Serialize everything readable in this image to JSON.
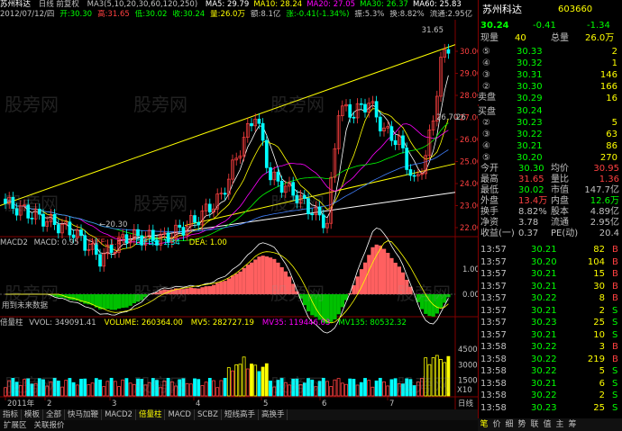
{
  "title": {
    "stock_name": "苏州科达",
    "code": "603660",
    "period_label": "日线 前复权"
  },
  "ma_header": {
    "label": "MA3(5,10,20,30,60,120,250)",
    "items": [
      {
        "text": "MA5: 29.79",
        "color": "#ffffff"
      },
      {
        "text": "MA10: 28.24",
        "color": "#ffff00"
      },
      {
        "text": "MA20: 27.05",
        "color": "#ff00ff"
      },
      {
        "text": "MA30: 26.37",
        "color": "#00ff00"
      },
      {
        "text": "MA60: 25.83",
        "color": "#ffffff"
      }
    ]
  },
  "info_header": {
    "items": [
      {
        "text": "2012/07/12/四",
        "color": "#c0c0c0"
      },
      {
        "text": "开:30.30",
        "color": "#00ff00"
      },
      {
        "text": "高:31.65",
        "color": "#ff4040"
      },
      {
        "text": "低:30.02",
        "color": "#00ff00"
      },
      {
        "text": "收:30.24",
        "color": "#00ff00"
      },
      {
        "text": "量:26.0万",
        "color": "#ffff00"
      },
      {
        "text": "额:8.1亿",
        "color": "#c0c0c0"
      },
      {
        "text": "涨:-0.41(-1.34%)",
        "color": "#00ff00"
      },
      {
        "text": "振:5.3%",
        "color": "#c0c0c0"
      },
      {
        "text": "换:8.82%",
        "color": "#c0c0c0"
      },
      {
        "text": "流通:2.95亿",
        "color": "#c0c0c0"
      }
    ]
  },
  "price_axis": [
    "30.00",
    "29.00",
    "28.00",
    "27.00",
    "26.00",
    "25.00",
    "24.00",
    "23.00",
    "22.00"
  ],
  "price_annotations": {
    "high": "31.65",
    "mid_label": "26.70",
    "mid_label2": "26",
    "low": "20.30"
  },
  "macd_header": {
    "name": "MACD2",
    "items": [
      {
        "text": "MACD: 0.95",
        "color": "#c0c0c0"
      },
      {
        "text": "DIFF: 1.47",
        "color": "#ff4040"
      },
      {
        "text": "DIFBS: 1.34",
        "color": "#00ffff"
      },
      {
        "text": "DEA: 1.00",
        "color": "#ffff00"
      }
    ],
    "axis": [
      "1.00",
      "0.00"
    ],
    "note": "用到未来数据"
  },
  "vol_header": {
    "name": "倍量柱",
    "items": [
      {
        "text": "VVOL: 349091.41",
        "color": "#c0c0c0"
      },
      {
        "text": "VOLUME: 260364.00",
        "color": "#ffff00"
      },
      {
        "text": "MV5: 282727.19",
        "color": "#ffff00"
      },
      {
        "text": "MV35: 119446.03",
        "color": "#ff00ff"
      },
      {
        "text": "MV135: 80532.32",
        "color": "#00ff00"
      }
    ],
    "axis": [
      "45000",
      "30000",
      "15000"
    ],
    "unit": "X10"
  },
  "x_axis": {
    "labels": [
      "2011年",
      "2",
      "3",
      "4",
      "5",
      "6",
      "7"
    ],
    "period": "日线"
  },
  "bottom_tabs": [
    "指标",
    "模板",
    "全部",
    "快马加鞭",
    "MACD2",
    "倍量柱",
    "MACD",
    "SCBZ",
    "短线高手",
    "高换手"
  ],
  "bottom_tabs_active": "倍量柱",
  "bottom_tabs2": [
    "扩展区",
    "关联报价"
  ],
  "right_panel": {
    "price": "30.24",
    "change": "-0.41",
    "pct": "-1.34",
    "current_label": "现量",
    "current_vol": "40",
    "total_label": "总量",
    "total_vol": "26.0万",
    "sell_orders": [
      {
        "level": "⑤",
        "price": "30.33",
        "vol": "2"
      },
      {
        "level": "④",
        "price": "30.32",
        "vol": "1"
      },
      {
        "level": "③",
        "price": "30.31",
        "vol": "146"
      },
      {
        "level": "②",
        "price": "30.30",
        "vol": "166"
      },
      {
        "level": "①",
        "price": "30.29",
        "vol": "16"
      }
    ],
    "sell_label": "卖盘",
    "buy_label": "买盘",
    "buy_orders": [
      {
        "level": "①",
        "price": "30.24",
        "vol": ""
      },
      {
        "level": "②",
        "price": "30.23",
        "vol": "5"
      },
      {
        "level": "③",
        "price": "30.22",
        "vol": "63"
      },
      {
        "level": "④",
        "price": "30.21",
        "vol": "86"
      },
      {
        "level": "⑤",
        "price": "30.20",
        "vol": "270"
      }
    ],
    "stats": [
      {
        "l1": "今开",
        "v1": "30.30",
        "c1": "#00ff00",
        "l2": "均价",
        "v2": "30.95",
        "c2": "#ff4040"
      },
      {
        "l1": "最高",
        "v1": "31.65",
        "c1": "#ff4040",
        "l2": "量比",
        "v2": "1.36",
        "c2": "#ff4040"
      },
      {
        "l1": "最低",
        "v1": "30.02",
        "c1": "#00ff00",
        "l2": "市值",
        "v2": "147.7亿",
        "c2": "#c0c0c0"
      },
      {
        "l1": "外盘",
        "v1": "13.4万",
        "c1": "#ff4040",
        "l2": "内盘",
        "v2": "12.6万",
        "c2": "#00ff00"
      },
      {
        "l1": "换手",
        "v1": "8.82%",
        "c1": "#c0c0c0",
        "l2": "股本",
        "v2": "4.89亿",
        "c2": "#c0c0c0"
      },
      {
        "l1": "净资",
        "v1": "3.78",
        "c1": "#c0c0c0",
        "l2": "流通",
        "v2": "2.95亿",
        "c2": "#c0c0c0"
      },
      {
        "l1": "收益(一)",
        "v1": "0.37",
        "c1": "#c0c0c0",
        "l2": "PE(动)",
        "v2": "20.4",
        "c2": "#c0c0c0"
      }
    ],
    "ticks": [
      {
        "time": "13:57",
        "price": "30.21",
        "vol": "82",
        "bs": "B"
      },
      {
        "time": "13:57",
        "price": "30.20",
        "vol": "104",
        "bs": "B"
      },
      {
        "time": "13:57",
        "price": "30.21",
        "vol": "15",
        "bs": "B"
      },
      {
        "time": "13:57",
        "price": "30.21",
        "vol": "30",
        "bs": "B"
      },
      {
        "time": "13:57",
        "price": "30.22",
        "vol": "8",
        "bs": "B"
      },
      {
        "time": "13:57",
        "price": "30.21",
        "vol": "2",
        "bs": "S"
      },
      {
        "time": "13:57",
        "price": "30.23",
        "vol": "25",
        "bs": "S"
      },
      {
        "time": "13:57",
        "price": "30.21",
        "vol": "10",
        "bs": "S"
      },
      {
        "time": "13:58",
        "price": "30.22",
        "vol": "3",
        "bs": "B"
      },
      {
        "time": "13:58",
        "price": "30.22",
        "vol": "219",
        "bs": "B"
      },
      {
        "time": "13:58",
        "price": "30.22",
        "vol": "5",
        "bs": "S"
      },
      {
        "time": "13:58",
        "price": "30.21",
        "vol": "6",
        "bs": "S"
      },
      {
        "time": "13:58",
        "price": "30.22",
        "vol": "2",
        "bs": "S"
      },
      {
        "time": "13:58",
        "price": "30.23",
        "vol": "25",
        "bs": "S"
      }
    ],
    "tabs": [
      "笔",
      "价",
      "细",
      "势",
      "联",
      "值",
      "主",
      "筹"
    ],
    "tab_active": "笔"
  },
  "watermark": "股旁网",
  "colors": {
    "up": "#ff4040",
    "down": "#00ff00",
    "axis": "#800000",
    "yellow": "#ffff00",
    "cyan": "#00ffff"
  }
}
